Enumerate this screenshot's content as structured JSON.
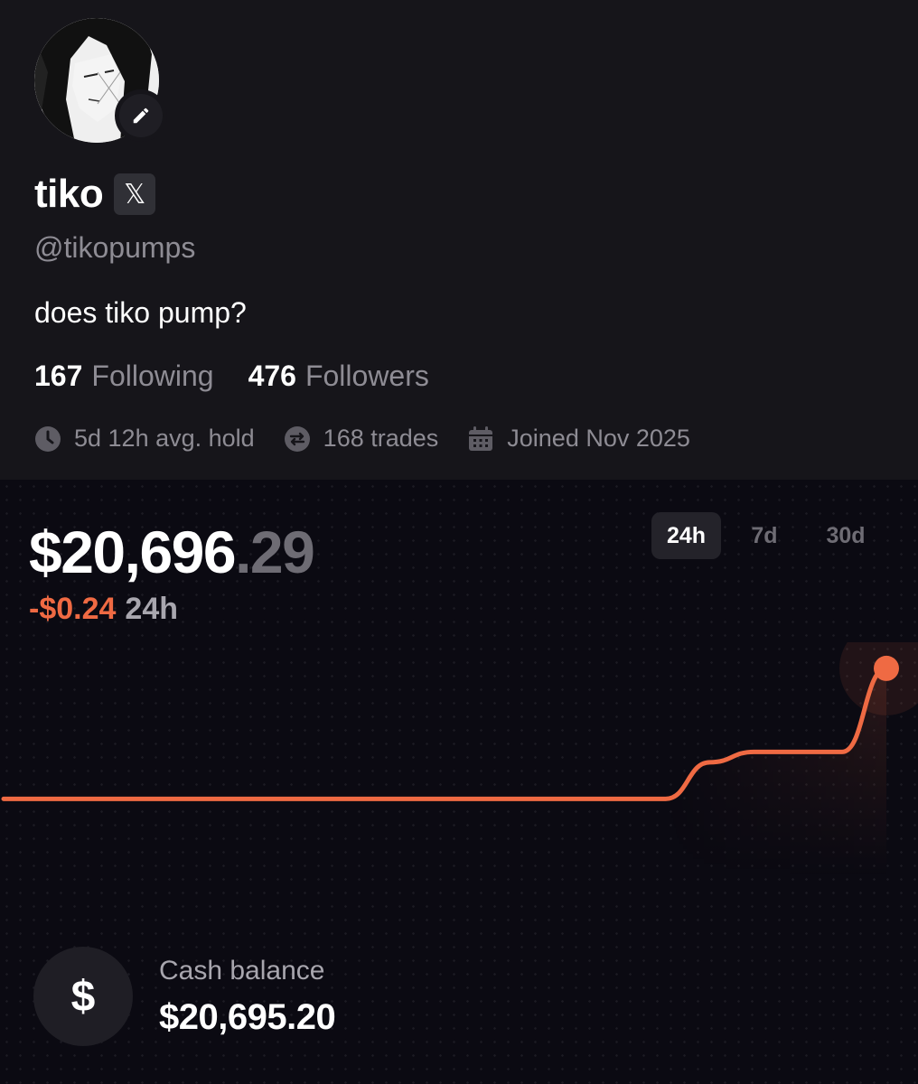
{
  "profile": {
    "display_name": "tiko",
    "x_badge": "𝕏",
    "handle": "@tikopumps",
    "bio": "does tiko pump?",
    "following_count": "167",
    "following_label": "Following",
    "followers_count": "476",
    "followers_label": "Followers",
    "avg_hold": "5d 12h avg. hold",
    "trades": "168 trades",
    "joined": "Joined Nov 2025",
    "icons": [
      "pencil-icon",
      "x-logo-icon",
      "clock-icon",
      "swap-icon",
      "calendar-icon"
    ]
  },
  "portfolio": {
    "value_main": "$20,696",
    "value_decimals": ".29",
    "change": "-$0.24",
    "change_period": "24h",
    "ranges": [
      "24h",
      "7d",
      "30d"
    ],
    "active_range": "24h",
    "colors": {
      "accent": "#ef6a43",
      "background": "#0b0a12",
      "panel": "#16151a"
    }
  },
  "cash": {
    "icon_symbol": "$",
    "label": "Cash balance",
    "value": "$20,695.20"
  },
  "chart_data": {
    "type": "line",
    "series": [
      {
        "values": [
          20695.2,
          20695.2,
          20695.2,
          20695.2,
          20695.2,
          20695.2,
          20695.2,
          20695.2,
          20695.2,
          20695.2,
          20695.2,
          20695.2,
          20695.2,
          20695.2,
          20695.2,
          20695.2,
          20695.27,
          20695.29,
          20695.29,
          20695.29,
          20695.45
        ]
      }
    ],
    "ylim": [
      20695.05,
      20695.5
    ],
    "grid": false
  }
}
